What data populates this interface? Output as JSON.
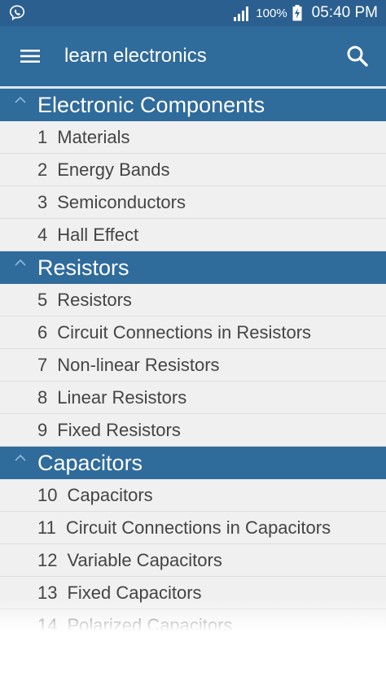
{
  "status_bar": {
    "app_icon": "viber-icon",
    "signal_icon": "signal-icon",
    "battery_percent": "100%",
    "battery_icon": "battery-charging-icon",
    "time": "05:40 PM"
  },
  "app_bar": {
    "menu_icon": "menu-icon",
    "title": "learn electronics",
    "search_icon": "search-icon"
  },
  "colors": {
    "header": "#2f6b9b",
    "status_bar": "#2a5f8f",
    "item_bg": "#f0f0f0",
    "item_text": "#444444"
  },
  "groups": [
    {
      "title": "Electronic Components",
      "items": [
        {
          "num": "1",
          "label": "Materials"
        },
        {
          "num": "2",
          "label": "Energy Bands"
        },
        {
          "num": "3",
          "label": "Semiconductors"
        },
        {
          "num": "4",
          "label": "Hall Effect"
        }
      ]
    },
    {
      "title": "Resistors",
      "items": [
        {
          "num": "5",
          "label": "Resistors"
        },
        {
          "num": "6",
          "label": "Circuit Connections in Resistors"
        },
        {
          "num": "7",
          "label": "Non-linear Resistors"
        },
        {
          "num": "8",
          "label": "Linear Resistors"
        },
        {
          "num": "9",
          "label": "Fixed Resistors"
        }
      ]
    },
    {
      "title": "Capacitors",
      "items": [
        {
          "num": "10",
          "label": "Capacitors"
        },
        {
          "num": "11",
          "label": "Circuit Connections in Capacitors"
        },
        {
          "num": "12",
          "label": "Variable Capacitors"
        },
        {
          "num": "13",
          "label": "Fixed Capacitors"
        },
        {
          "num": "14",
          "label": "Polarized Capacitors"
        }
      ]
    }
  ]
}
